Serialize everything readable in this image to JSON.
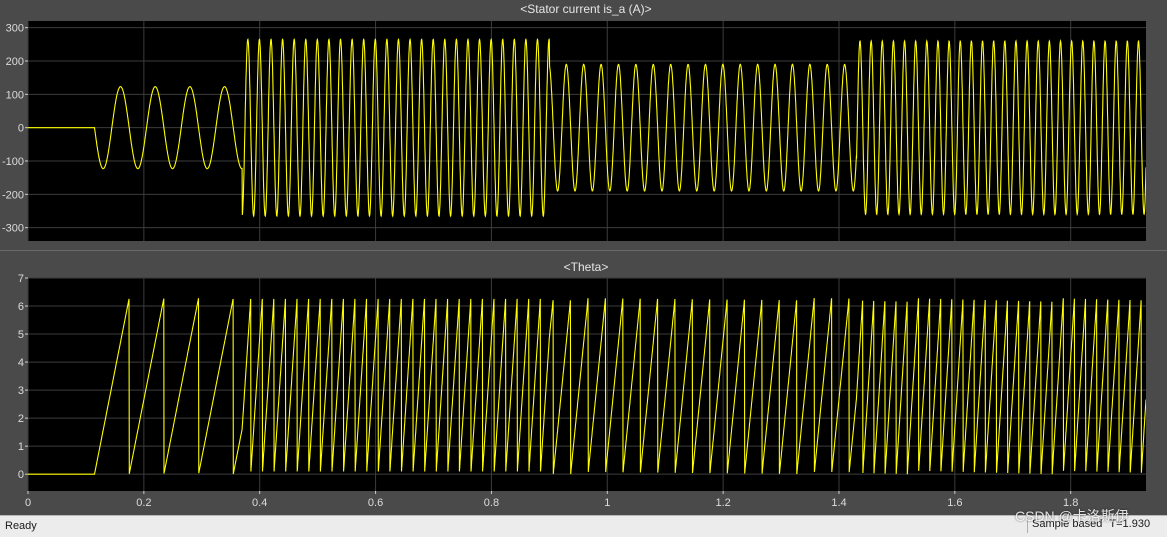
{
  "status": {
    "ready": "Ready",
    "sample_based": "Sample based",
    "time": "T=1.930"
  },
  "watermark": "CSDN @卡洛斯伊",
  "colors": {
    "background": "#000000",
    "grid": "#3c3c3c",
    "trace": "#ffff00",
    "frame": "#4a4a4a"
  },
  "chart_data": [
    {
      "type": "line",
      "title": "<Stator current is_a (A)>",
      "xlim": [
        0,
        1.93
      ],
      "ylim": [
        -340,
        320
      ],
      "yticks": [
        300,
        200,
        100,
        0,
        -100,
        -200,
        -300
      ],
      "xticks": [
        0,
        0.2,
        0.4,
        0.6,
        0.8,
        1,
        1.2,
        1.4,
        1.6,
        1.8
      ],
      "show_xtick_labels": false,
      "grid": true,
      "series": [
        {
          "segments": [
            {
              "t_start": 0,
              "t_end": 0.115,
              "kind": "constant",
              "value": 0
            },
            {
              "t_start": 0.115,
              "t_end": 0.37,
              "kind": "sine",
              "amplitude": 123,
              "frequency_hz": 16.7,
              "phase_start": "negative"
            },
            {
              "t_start": 0.37,
              "t_end": 0.9,
              "kind": "sine",
              "amplitude": 265,
              "frequency_hz": 50
            },
            {
              "t_start": 0.9,
              "t_end": 1.43,
              "kind": "sine",
              "amplitude": 190,
              "frequency_hz": 33.3
            },
            {
              "t_start": 1.43,
              "t_end": 1.93,
              "kind": "sine",
              "amplitude": 260,
              "frequency_hz": 52
            }
          ]
        }
      ]
    },
    {
      "type": "line",
      "title": "<Theta>",
      "xlim": [
        0,
        1.93
      ],
      "ylim": [
        -0.6,
        7
      ],
      "yticks": [
        7,
        6,
        5,
        4,
        3,
        2,
        1,
        0
      ],
      "xticks": [
        0,
        0.2,
        0.4,
        0.6,
        0.8,
        1,
        1.2,
        1.4,
        1.6,
        1.8
      ],
      "xtick_labels": [
        "0",
        "0.2",
        "0.4",
        "0.6",
        "0.8",
        "1",
        "1.2",
        "1.4",
        "1.6",
        "1.8"
      ],
      "show_xtick_labels": true,
      "grid": true,
      "series": [
        {
          "kind": "sawtooth",
          "min": 0,
          "max": 6.28,
          "segments": [
            {
              "t_start": 0,
              "t_end": 0.115,
              "kind": "constant",
              "value": 0
            },
            {
              "t_start": 0.115,
              "t_end": 0.37,
              "kind": "ramp",
              "frequency_hz": 16.7
            },
            {
              "t_start": 0.37,
              "t_end": 0.9,
              "kind": "ramp",
              "frequency_hz": 50
            },
            {
              "t_start": 0.9,
              "t_end": 1.43,
              "kind": "ramp",
              "frequency_hz": 33.3
            },
            {
              "t_start": 1.43,
              "t_end": 1.93,
              "kind": "ramp",
              "frequency_hz": 52
            }
          ]
        }
      ]
    }
  ]
}
